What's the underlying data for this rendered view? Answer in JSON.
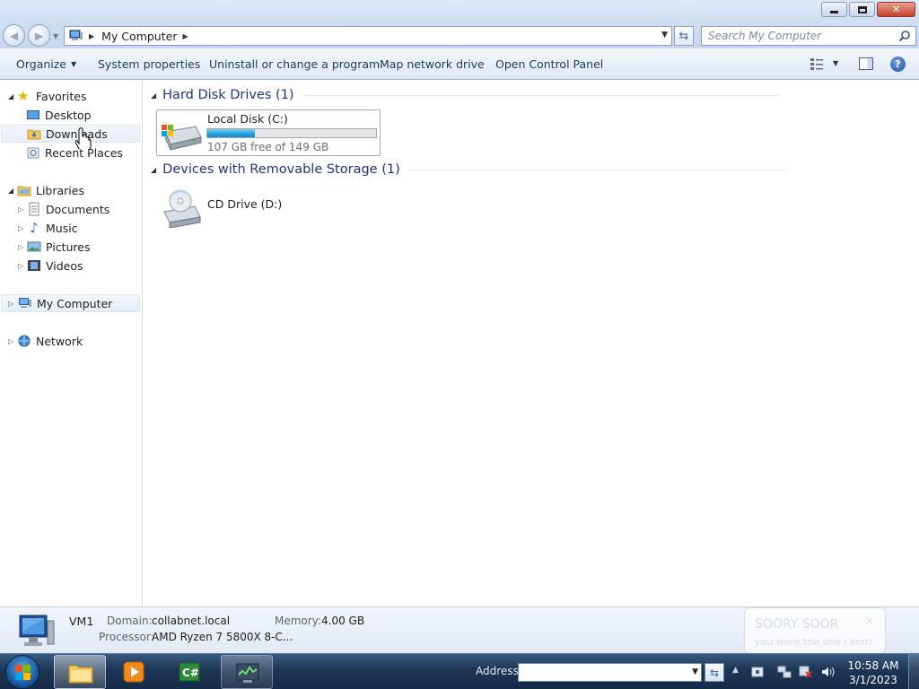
{
  "window": {
    "minimize_label": "–",
    "maximize_label": "",
    "close_label": "✕"
  },
  "address": {
    "crumb": "My Computer",
    "search_placeholder": "Search My Computer"
  },
  "toolbar": {
    "organize": "Organize",
    "system_properties": "System properties",
    "uninstall": "Uninstall or change a program",
    "map_drive": "Map network drive",
    "control_panel": "Open Control Panel"
  },
  "nav": {
    "favorites": "Favorites",
    "desktop": "Desktop",
    "downloads": "Downloads",
    "recent": "Recent Places",
    "libraries": "Libraries",
    "documents": "Documents",
    "music": "Music",
    "pictures": "Pictures",
    "videos": "Videos",
    "computer": "My Computer",
    "network": "Network"
  },
  "content": {
    "hdd_group": "Hard Disk Drives (1)",
    "removable_group": "Devices with Removable Storage (1)",
    "drives": [
      {
        "name": "Local Disk (C:)",
        "free_text": "107 GB free of 149 GB",
        "used_fraction": 0.28
      },
      {
        "name": "CD Drive (D:)"
      }
    ]
  },
  "details": {
    "computer_name": "VM1",
    "domain_label": "Domain:",
    "domain_value": "collabnet.local",
    "memory_label": "Memory:",
    "memory_value": "4.00 GB",
    "processor_label": "Processor:",
    "processor_value": "AMD Ryzen 7 5800X 8-C..."
  },
  "toast": {
    "title": "SOORY SOOR",
    "body": "you were the one i kerrr",
    "close": "×"
  },
  "taskbar": {
    "address_label": "Address",
    "address_value": "",
    "time": "10:58 AM",
    "date": "3/1/2023"
  },
  "colors": {
    "titlebar": "#dde9f6",
    "command_bar": "#e6eef8",
    "group_header": "#1e3287",
    "capacity_fill": "#26a0da",
    "taskbar": "#1e3655"
  }
}
